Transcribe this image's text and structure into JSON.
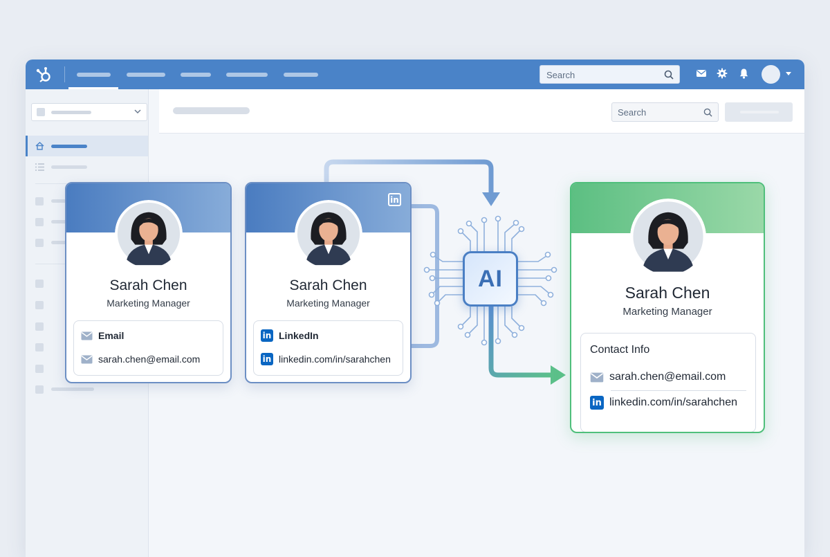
{
  "topbar": {
    "search_placeholder": "Search"
  },
  "content_header": {
    "search_placeholder": "Search"
  },
  "cards": {
    "email_card": {
      "name": "Sarah Chen",
      "role": "Marketing Manager",
      "field_label": "Email",
      "field_value": "sarah.chen@email.com"
    },
    "linkedin_card": {
      "name": "Sarah Chen",
      "role": "Marketing Manager",
      "field_label": "LinkedIn",
      "field_value": "linkedin.com/in/sarahchen",
      "badge": "in"
    },
    "merged_card": {
      "name": "Sarah Chen",
      "role": "Marketing Manager",
      "section_title": "Contact Info",
      "email": "sarah.chen@email.com",
      "linkedin": "linkedin.com/in/sarahchen"
    }
  },
  "ai_chip": {
    "label": "AI"
  },
  "icons": {
    "linkedin_glyph": "in"
  },
  "colors": {
    "brand_blue": "#4a83c8",
    "linkedin_blue": "#0a66c2",
    "merge_green": "#4fbf7b"
  }
}
